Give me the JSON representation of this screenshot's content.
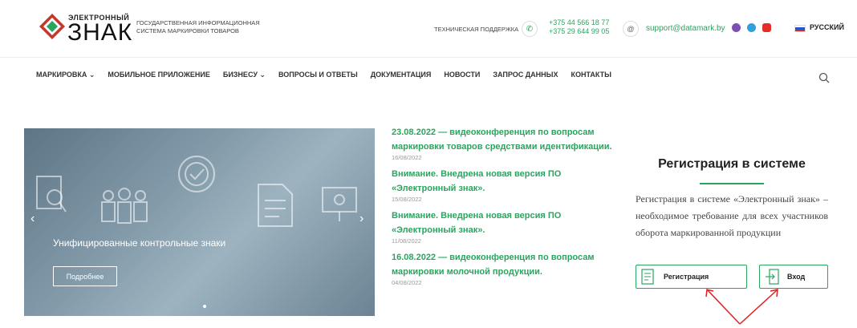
{
  "header": {
    "logo_small": "ЭЛЕКТРОННЫЙ",
    "logo_big": "ЗНАК",
    "tagline_line1": "ГОСУДАРСТВЕННАЯ ИНФОРМАЦИОННАЯ",
    "tagline_line2": "СИСТЕМА МАРКИРОВКИ ТОВАРОВ",
    "support_label": "ТЕХНИЧЕСКАЯ ПОДДЕРЖКА",
    "phone1": "+375 44 566 18 77",
    "phone2": "+375 29 644 99 05",
    "email": "support@datamark.by",
    "language": "РУССКИЙ",
    "icons": [
      "phone-icon",
      "at-icon",
      "viber-icon",
      "telegram-icon",
      "youtube-icon",
      "flag-icon"
    ]
  },
  "nav": {
    "items": [
      "МАРКИРОВКА ⌄",
      "МОБИЛЬНОЕ ПРИЛОЖЕНИЕ",
      "БИЗНЕСУ ⌄",
      "ВОПРОСЫ И ОТВЕТЫ",
      "ДОКУМЕНТАЦИЯ",
      "НОВОСТИ",
      "ЗАПРОС ДАННЫХ",
      "КОНТАКТЫ"
    ]
  },
  "slider": {
    "title": "Унифицированные контрольные знаки",
    "button": "Подробнее",
    "prev": "‹",
    "next": "›"
  },
  "news": [
    {
      "title": "23.08.2022 — видеоконференция по вопросам маркировки товаров средствами идентификации.",
      "date": "16/08/2022"
    },
    {
      "title": "Внимание. Внедрена новая версия ПО «Электронный знак».",
      "date": "15/08/2022"
    },
    {
      "title": "Внимание. Внедрена новая версия ПО «Электронный знак».",
      "date": "11/08/2022"
    },
    {
      "title": "16.08.2022 — видеоконференция по вопросам маркировки молочной продукции.",
      "date": "04/08/2022"
    }
  ],
  "registration": {
    "title": "Регистрация в системе",
    "text": "Регистрация в системе «Электронный знак» – необходимое требование для всех участников оборота маркированной продукции",
    "register_button": "Регистрация",
    "login_button": "Вход"
  },
  "colors": {
    "accent": "#29a55f",
    "annotation": "#e02020"
  }
}
